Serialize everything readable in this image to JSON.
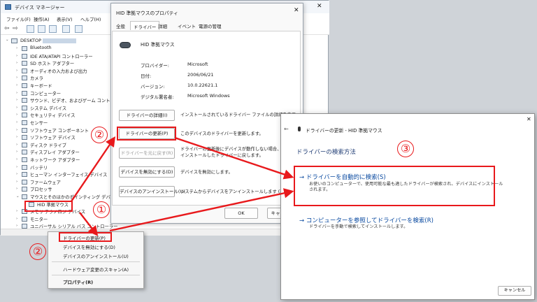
{
  "devmgr": {
    "title": "デバイス マネージャー",
    "menu": [
      "ファイル(F)",
      "操作(A)",
      "表示(V)",
      "ヘルプ(H)"
    ],
    "root": "DESKTOP",
    "tree": [
      "Bluetooth",
      "IDE ATA/ATAPI コントローラー",
      "SD ホスト アダプター",
      "オーディオの入力および出力",
      "カメラ",
      "キーボード",
      "コンピューター",
      "サウンド、ビデオ、およびゲーム コントローラー",
      "システム デバイス",
      "セキュリティ デバイス",
      "センサー",
      "ソフトウェア コンポーネント",
      "ソフトウェア デバイス",
      "ディスク ドライブ",
      "ディスプレイ アダプター",
      "ネットワーク アダプター",
      "バッテリ",
      "ヒューマン インターフェイス デバイス",
      "ファームウェア",
      "プロセッサ",
      "マウスとそのほかのポインティング デバイス",
      "HID 準拠マウス",
      "メモリ テクノロジ デバイス",
      "モニター",
      "ユニバーサル シリアル バス コントローラー"
    ]
  },
  "props": {
    "title": "HID 準拠マウスのプロパティ",
    "tabs": [
      "全般",
      "ドライバー",
      "詳細",
      "イベント",
      "電源の管理"
    ],
    "device_name": "HID 準拠マウス",
    "info": [
      {
        "label": "プロバイダー:",
        "value": "Microsoft"
      },
      {
        "label": "日付:",
        "value": "2006/06/21"
      },
      {
        "label": "バージョン:",
        "value": "10.0.22621.1"
      },
      {
        "label": "デジタル署名者:",
        "value": "Microsoft Windows"
      }
    ],
    "buttons": [
      {
        "label": "ドライバーの詳細(I)",
        "desc": "インストールされているドライバー ファイルの詳細を表示"
      },
      {
        "label": "ドライバーの更新(P)",
        "desc": "このデバイスのドライバーを更新します。"
      },
      {
        "label": "ドライバーを元に戻す(R)",
        "desc": "ドライバーの更新後にデバイスが動作しない場合、以 インストールしたドライバーに戻します。"
      },
      {
        "label": "デバイスを無効にする(D)",
        "desc": "デバイスを無効にします。"
      },
      {
        "label": "デバイスのアンインストール(U)",
        "desc": "システムからデバイスをアンインストールします (高度)。"
      }
    ],
    "ok": "OK",
    "cancel": "キャ"
  },
  "wizard": {
    "title": "ドライバーの更新 - HID 準拠マウス",
    "heading": "ドライバーの検索方法",
    "opt1_title": "→ ドライバーを自動的に検索(S)",
    "opt1_desc1": "お使いのコンピューターで、使用可能な最も適したドライバーが検索され、デバイスにインストール",
    "opt1_desc2": "されます。",
    "opt2_title": "→ コンピューターを参照してドライバーを検索(R)",
    "opt2_desc": "ドライバーを手動で検索してインストールします。",
    "cancel": "キャンセル"
  },
  "ctx": {
    "items": [
      "ドライバーの更新(P)",
      "デバイスを無効にする(D)",
      "デバイスのアンインストール(U)",
      "ハードウェア変更のスキャン(A)",
      "プロパティ(R)"
    ]
  },
  "annotations": {
    "n1": "①",
    "n2": "②",
    "n3": "③",
    "color": "#e8191c"
  },
  "colors": {
    "link": "#0a4aa0"
  }
}
